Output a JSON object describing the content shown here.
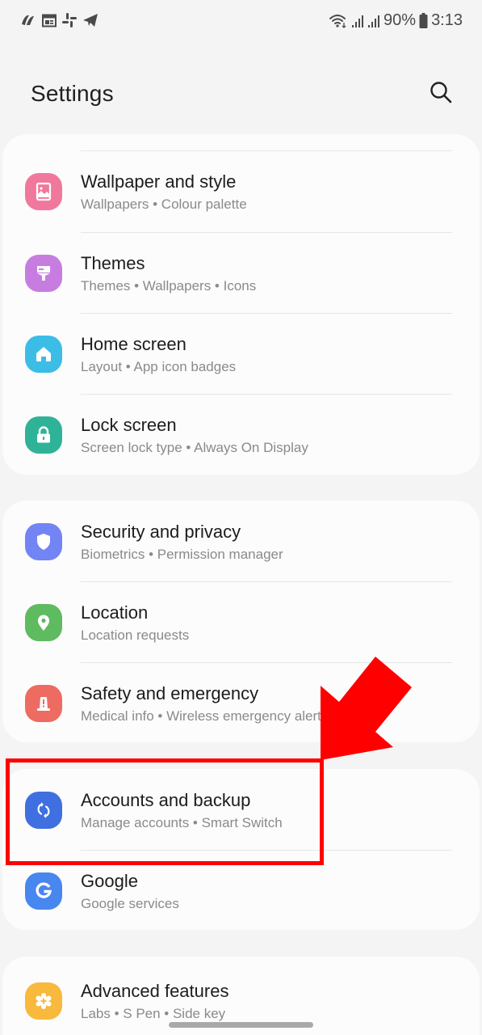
{
  "status_bar": {
    "notification_icons": [
      "app-swirl-icon",
      "calendar-news-icon",
      "slack-icon",
      "telegram-icon"
    ],
    "wifi": "wifi-icon",
    "signal_bars": [
      "signal-icon-sim1",
      "signal-icon-sim2"
    ],
    "battery_percent": "90%",
    "battery_icon": "battery-icon",
    "time": "3:13"
  },
  "header": {
    "title": "Settings",
    "search_icon": "search-icon"
  },
  "groups": [
    {
      "items": [
        {
          "id": "wallpaper",
          "title": "Wallpaper and style",
          "subtitle": "Wallpapers  •  Colour palette",
          "icon": "wallpaper-icon",
          "color": "#f0789c"
        },
        {
          "id": "themes",
          "title": "Themes",
          "subtitle": "Themes  •  Wallpapers  •  Icons",
          "icon": "themes-brush-icon",
          "color": "#c77de0"
        },
        {
          "id": "home-screen",
          "title": "Home screen",
          "subtitle": "Layout  •  App icon badges",
          "icon": "home-icon",
          "color": "#3cbde6"
        },
        {
          "id": "lock-screen",
          "title": "Lock screen",
          "subtitle": "Screen lock type  •  Always On Display",
          "icon": "lock-icon",
          "color": "#2fb398"
        }
      ]
    },
    {
      "items": [
        {
          "id": "security",
          "title": "Security and privacy",
          "subtitle": "Biometrics  •  Permission manager",
          "icon": "shield-icon",
          "color": "#7384f5"
        },
        {
          "id": "location",
          "title": "Location",
          "subtitle": "Location requests",
          "icon": "location-pin-icon",
          "color": "#5fbb5f"
        },
        {
          "id": "safety",
          "title": "Safety and emergency",
          "subtitle": "Medical info  •  Wireless emergency alerts",
          "icon": "emergency-siren-icon",
          "color": "#ee6b62"
        }
      ]
    },
    {
      "items": [
        {
          "id": "accounts",
          "title": "Accounts and backup",
          "subtitle": "Manage accounts  •  Smart Switch",
          "icon": "sync-icon",
          "color": "#3f6fe0"
        },
        {
          "id": "google",
          "title": "Google",
          "subtitle": "Google services",
          "icon": "google-g-icon",
          "color": "#4886f0"
        }
      ]
    },
    {
      "items": [
        {
          "id": "advanced",
          "title": "Advanced features",
          "subtitle": "Labs  •  S Pen  •  Side key",
          "icon": "advanced-gear-plus-icon",
          "color": "#f8b93c"
        }
      ]
    }
  ],
  "annotation": {
    "highlight_target": "Accounts and backup",
    "highlight_color": "#ff0000",
    "arrow_color": "#ff0000"
  }
}
